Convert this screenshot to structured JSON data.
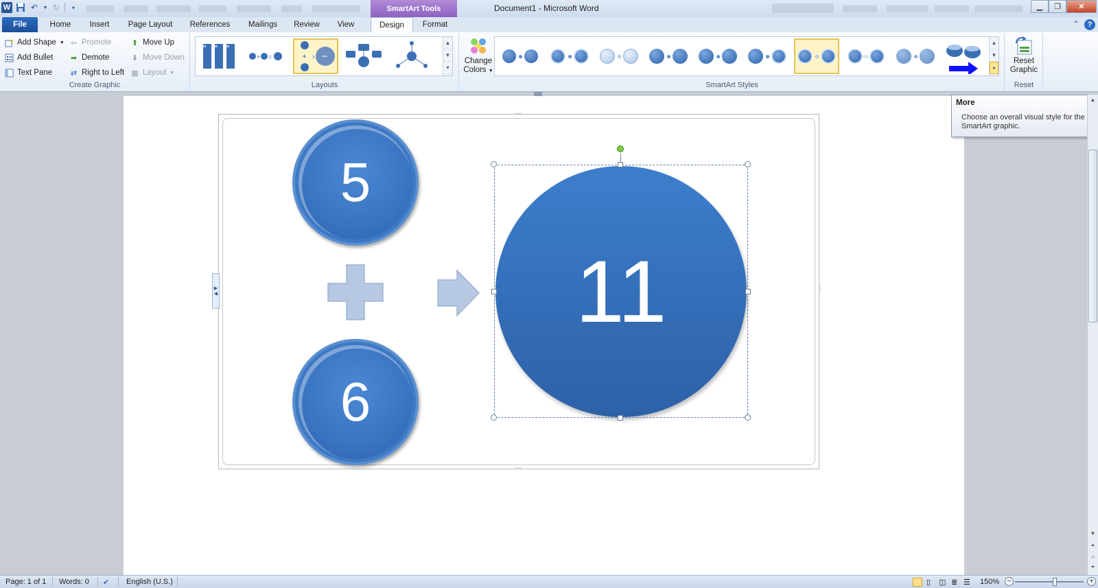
{
  "titlebar": {
    "app_icon": "word-icon",
    "contextual_tab": "SmartArt Tools",
    "document_title": "Document1  -  Microsoft Word"
  },
  "tabs": [
    "File",
    "Home",
    "Insert",
    "Page Layout",
    "References",
    "Mailings",
    "Review",
    "View",
    "Design",
    "Format"
  ],
  "active_tab": "Design",
  "ribbon": {
    "create_graphic": {
      "label": "Create Graphic",
      "add_shape": "Add Shape",
      "add_bullet": "Add Bullet",
      "text_pane": "Text Pane",
      "promote": "Promote",
      "demote": "Demote",
      "right_to_left": "Right to Left",
      "move_up": "Move Up",
      "move_down": "Move Down",
      "layout": "Layout"
    },
    "layouts": {
      "label": "Layouts"
    },
    "smartart_styles": {
      "label": "SmartArt Styles",
      "change_colors_line1": "Change",
      "change_colors_line2": "Colors"
    },
    "reset": {
      "label": "Reset",
      "reset_graphic_line1": "Reset",
      "reset_graphic_line2": "Graphic"
    }
  },
  "tooltip": {
    "title": "More",
    "body": "Choose an overall visual style for the SmartArt graphic."
  },
  "smartart": {
    "node_top": "5",
    "node_bottom": "6",
    "node_result": "11"
  },
  "statusbar": {
    "page": "Page: 1 of 1",
    "words": "Words: 0",
    "language": "English (U.S.)",
    "zoom": "150%"
  },
  "colors": {
    "node_blue": "#3b75c2",
    "operator_fill": "#b6c8e2",
    "annotation_arrow": "#1010ff",
    "contextual_purple": "#8c5fc0"
  }
}
